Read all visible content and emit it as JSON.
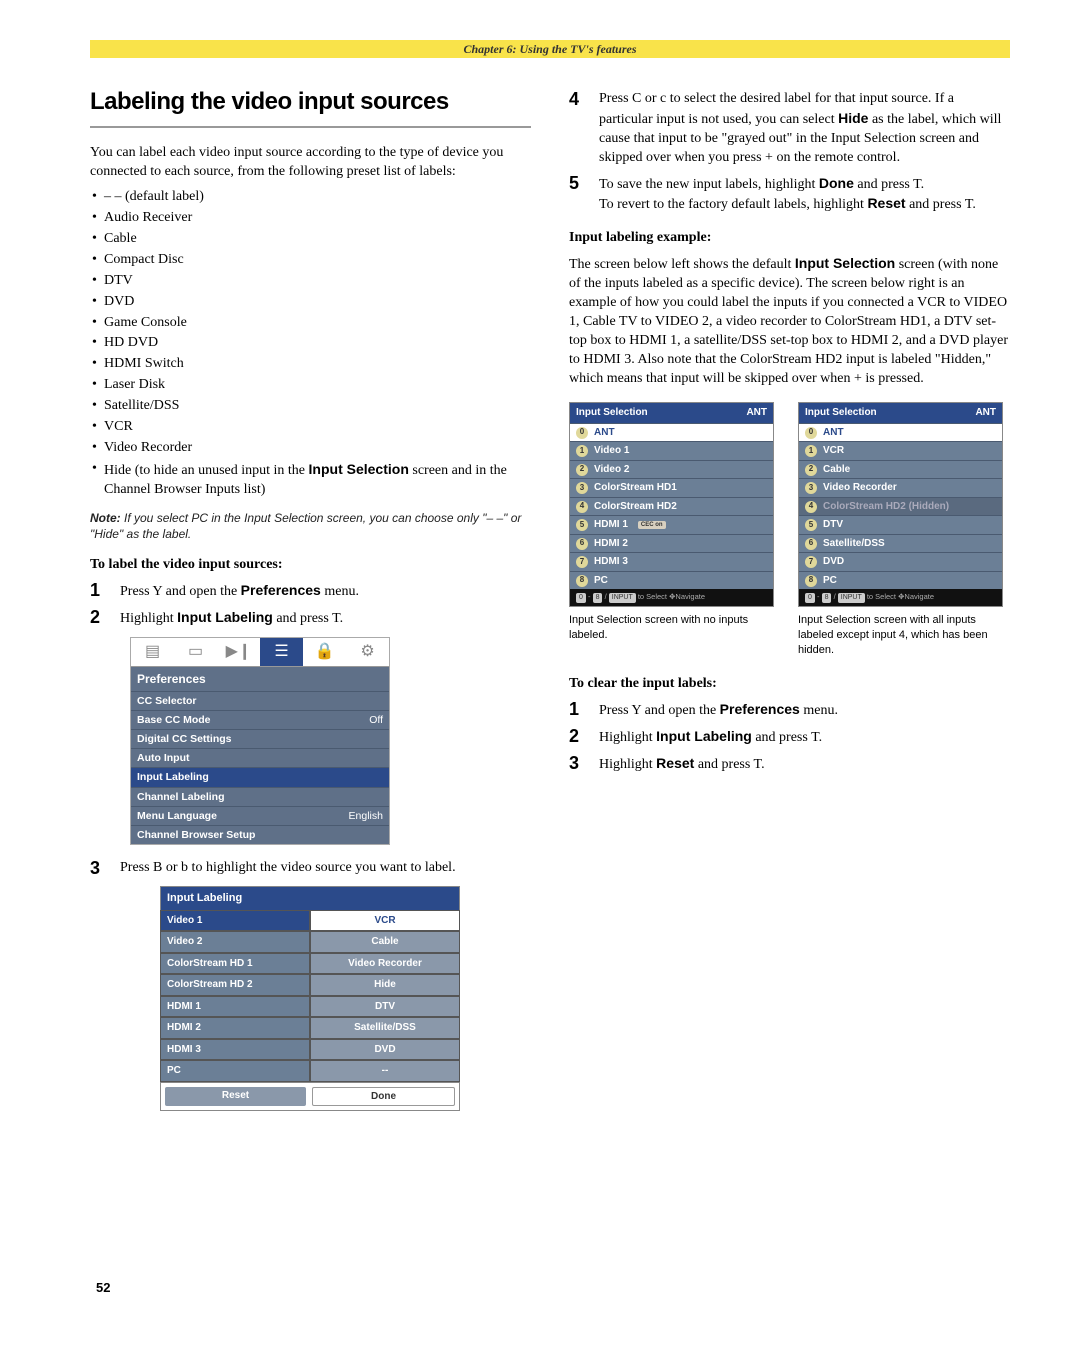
{
  "chapter": "Chapter 6: Using the TV's features",
  "left": {
    "title": "Labeling the video input sources",
    "intro": "You can label each video input source according to the type of device you connected to each source, from the following preset list of labels:",
    "labels": [
      "– – (default label)",
      "Audio Receiver",
      "Cable",
      "Compact Disc",
      "DTV",
      "DVD",
      "Game Console",
      "HD DVD",
      "HDMI Switch",
      "Laser Disk",
      "Satellite/DSS",
      "VCR",
      "Video Recorder"
    ],
    "hide_item_pre": "Hide (to hide an unused input in the ",
    "hide_bold": "Input Selection",
    "hide_item_post": " screen and in the Channel Browser Inputs list)",
    "note_pre": "Note:",
    "note_body": " If you select PC in the Input Selection screen, you can choose only \"– –\" or \"Hide\"  as the label.",
    "sub_h": "To label the video input sources:",
    "s1_a": "Press ",
    "s1_b": " and open the ",
    "s1_c": "Preferences",
    "s1_d": " menu.",
    "s2_a": "Highlight ",
    "s2_b": "Input Labeling",
    "s2_c": " and press ",
    "s2_d": ".",
    "s3": "Press B or b to highlight the video source you want to label.",
    "key_Y": "Y",
    "key_T": "T",
    "pref": {
      "title": "Preferences",
      "rows": [
        {
          "l": "CC Selector",
          "v": ""
        },
        {
          "l": "Base CC Mode",
          "v": "Off"
        },
        {
          "l": "Digital CC Settings",
          "v": ""
        },
        {
          "l": "Auto Input",
          "v": ""
        },
        {
          "l": "Input Labeling",
          "v": "",
          "hl": true
        },
        {
          "l": "Channel Labeling",
          "v": ""
        },
        {
          "l": "Menu Language",
          "v": "English"
        },
        {
          "l": "Channel Browser Setup",
          "v": ""
        }
      ]
    },
    "lab": {
      "title": "Input Labeling",
      "rows": [
        {
          "l": "Video 1",
          "r": "VCR",
          "hl": true
        },
        {
          "l": "Video 2",
          "r": "Cable"
        },
        {
          "l": "ColorStream HD 1",
          "r": "Video Recorder"
        },
        {
          "l": "ColorStream HD 2",
          "r": "Hide"
        },
        {
          "l": "HDMI 1",
          "r": "DTV"
        },
        {
          "l": "HDMI 2",
          "r": "Satellite/DSS"
        },
        {
          "l": "HDMI 3",
          "r": "DVD"
        },
        {
          "l": "PC",
          "r": "--"
        }
      ],
      "reset": "Reset",
      "done": "Done"
    }
  },
  "right": {
    "s4_pre": "Press C or c to select the desired label for that input source. If a particular input is not used, you can select ",
    "s4_hide": "Hide",
    "s4_mid": " as the label, which will cause that input to be \"grayed out\" in the Input Selection screen and skipped over when you press ",
    "s4_plus": "+",
    "s4_end": " on the remote control.",
    "s5_a": "To save the new input labels, highlight ",
    "s5_done": "Done",
    "s5_b": " and press ",
    "s5_T": "T",
    "s5_c": ".",
    "s5_r_a": "To revert to the factory default labels, highlight ",
    "s5_reset": "Reset",
    "s5_r_b": " and press ",
    "s5_r_c": ".",
    "ex_h": "Input labeling example:",
    "ex_p_pre": "The screen below left shows the default ",
    "ex_p_bold": "Input Selection",
    "ex_p_post": " screen (with none of the inputs labeled as a specific device). The screen below right is an example of how you could label the inputs if you connected a VCR to VIDEO 1, Cable TV to VIDEO 2, a video recorder to ColorStream HD1, a DTV set-top box to HDMI 1, a satellite/DSS set-top box to HDMI 2, and a DVD player to HDMI 3. Also note that the ColorStream HD2 input is labeled \"Hidden,\" which means that input will be skipped over when + is pressed.",
    "card1": {
      "title": "Input Selection",
      "ant": "ANT",
      "items": [
        {
          "n": "0",
          "t": "ANT",
          "sel": true
        },
        {
          "n": "1",
          "t": "Video 1"
        },
        {
          "n": "2",
          "t": "Video 2"
        },
        {
          "n": "3",
          "t": "ColorStream HD1"
        },
        {
          "n": "4",
          "t": "ColorStream HD2"
        },
        {
          "n": "5",
          "t": "HDMI 1",
          "tag": "CEC on"
        },
        {
          "n": "6",
          "t": "HDMI 2"
        },
        {
          "n": "7",
          "t": "HDMI 3"
        },
        {
          "n": "8",
          "t": "PC"
        }
      ],
      "ftr_a": "0",
      "ftr_b": "8",
      "ftr_c": "INPUT",
      "ftr_d": " to Select ",
      "ftr_e": "Navigate"
    },
    "card2": {
      "title": "Input Selection",
      "ant": "ANT",
      "items": [
        {
          "n": "0",
          "t": "ANT",
          "sel": true
        },
        {
          "n": "1",
          "t": "VCR"
        },
        {
          "n": "2",
          "t": "Cable"
        },
        {
          "n": "3",
          "t": "Video Recorder"
        },
        {
          "n": "4",
          "t": "ColorStream HD2 (Hidden)",
          "hid": true
        },
        {
          "n": "5",
          "t": "DTV"
        },
        {
          "n": "6",
          "t": "Satellite/DSS"
        },
        {
          "n": "7",
          "t": "DVD"
        },
        {
          "n": "8",
          "t": "PC"
        }
      ]
    },
    "cap1": "Input Selection screen with no inputs labeled.",
    "cap2": "Input Selection screen with all inputs labeled except input 4, which has been hidden.",
    "clear_h": "To clear the input labels:",
    "c1_a": "Press ",
    "c1_b": " and open the ",
    "c1_c": "Preferences",
    "c1_d": " menu.",
    "c2_a": "Highlight ",
    "c2_b": "Input Labeling",
    "c2_c": " and press ",
    "c2_d": ".",
    "c3_a": "Highlight ",
    "c3_b": "Reset",
    "c3_c": " and press ",
    "c3_d": "."
  },
  "nums": {
    "n1": "1",
    "n2": "2",
    "n3": "3",
    "n4": "4",
    "n5": "5"
  },
  "pagenum": "52"
}
